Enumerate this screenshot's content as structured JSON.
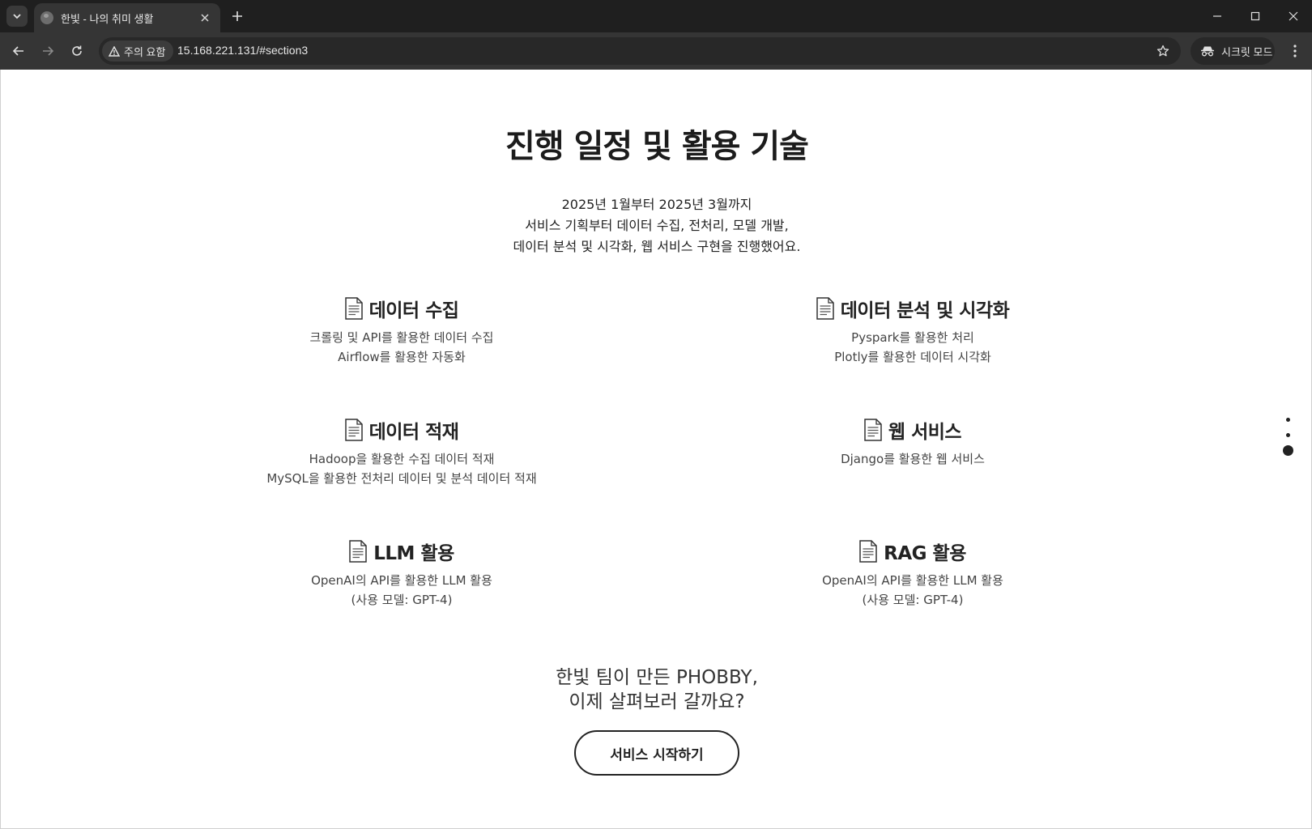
{
  "browser": {
    "tab_title": "한빛 - 나의 취미 생활",
    "security_label": "주의 요함",
    "url": "15.168.221.131/#section3",
    "incognito_label": "시크릿 모드"
  },
  "page": {
    "title": "진행 일정 및 활용 기술",
    "intro_lines": [
      "2025년 1월부터 2025년 3월까지",
      "서비스 기획부터 데이터 수집, 전처리, 모델 개발,",
      "데이터 분석 및 시각화, 웹 서비스 구현을 진행했어요."
    ],
    "features": [
      {
        "title": "데이터 수집",
        "lines": [
          "크롤링 및 API를 활용한 데이터 수집",
          "Airflow를 활용한 자동화"
        ]
      },
      {
        "title": "데이터 분석 및 시각화",
        "lines": [
          "Pyspark를 활용한 처리",
          "Plotly를 활용한 데이터 시각화"
        ]
      },
      {
        "title": "데이터 적재",
        "lines": [
          "Hadoop을 활용한 수집 데이터 적재",
          "MySQL을 활용한 전처리 데이터 및 분석 데이터 적재"
        ]
      },
      {
        "title": "웹 서비스",
        "lines": [
          "Django를 활용한 웹 서비스"
        ]
      },
      {
        "title": "LLM 활용",
        "lines": [
          "OpenAI의 API를 활용한 LLM 활용",
          "(사용 모델: GPT-4)"
        ]
      },
      {
        "title": "RAG 활용",
        "lines": [
          "OpenAI의 API를 활용한 LLM 활용",
          "(사용 모델: GPT-4)"
        ]
      }
    ],
    "outro_lines": [
      "한빛 팀이 만든 PHOBBY,",
      "이제 살펴보러 갈까요?"
    ],
    "cta_label": "서비스 시작하기",
    "section_nav": {
      "count": 3,
      "active_index": 2
    }
  },
  "icons": {
    "feature": "document-icon",
    "security": "warning-triangle-icon",
    "incognito": "incognito-icon"
  }
}
